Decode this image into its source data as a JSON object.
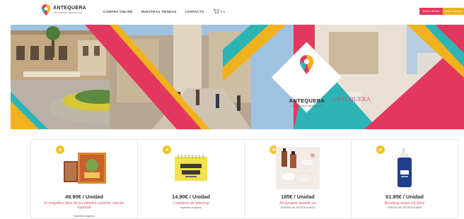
{
  "header": {
    "logo_name": "ANTEQUERA",
    "logo_tagline": "TUS COMPRAS SIEMPRE AQUÍ",
    "nav": [
      "COMPRA ONLINE",
      "NUESTRAS TIENDAS",
      "CONTACTO"
    ],
    "cart_total": "0 €",
    "register_label": "Acceso clientes",
    "login_label": "Acceso comercio"
  },
  "hero": {
    "logo_name": "ANTEQUERA",
    "logo_tagline": "TUS COMPRAS SIEMPRE AQUÍ",
    "sign_text": "ANTEQUERA"
  },
  "products": [
    {
      "price": "49.90€ / Unidad",
      "name": "El magnífico libro de los infinitos cuentos: edición especial",
      "vendor": "Imprenta Graphics"
    },
    {
      "price": "14.90€ / Unidad",
      "name": "Cuaderno de lettering",
      "vendor": "Imprenta Graphics"
    },
    {
      "price": "185€ / Unidad",
      "name": "4d dynamic benefit set",
      "vendor": "CENTRO DE ESTÉTICA ARIS"
    },
    {
      "price": "61.95€ / Unidad",
      "name": "Boosting cream (rf) 80ml",
      "vendor": "CENTRO DE ESTÉTICA ARIS"
    }
  ],
  "colors": {
    "pink": "#e3385d",
    "yellow": "#f2b21d",
    "teal": "#2db5b5",
    "star": "#f4c224"
  },
  "icons": [
    "logo-pin-icon",
    "cart-icon",
    "star-icon"
  ]
}
